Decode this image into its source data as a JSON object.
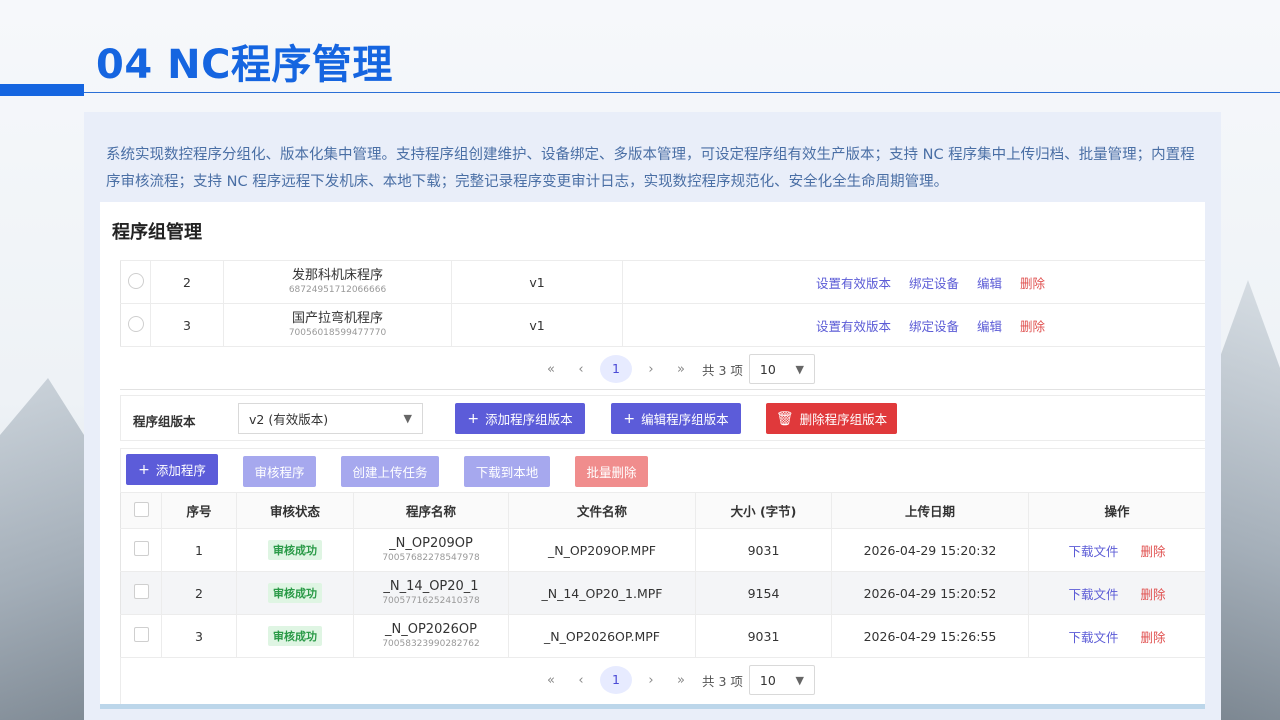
{
  "page": {
    "title": "04 NC程序管理",
    "description": "系统实现数控程序分组化、版本化集中管理。支持程序组创建维护、设备绑定、多版本管理，可设定程序组有效生产版本；支持 NC 程序集中上传归档、批量管理；内置程序审核流程；支持 NC 程序远程下发机床、本地下载；完整记录程序变更审计日志，实现数控程序规范化、安全化全生命周期管理。"
  },
  "colors": {
    "accent": "#1565e0",
    "primary": "#5c5cd9",
    "danger": "#e0393b",
    "success": "#2a9a47"
  },
  "card": {
    "title": "程序组管理"
  },
  "groups": {
    "rows": [
      {
        "index": "2",
        "name": "发那科机床程序",
        "id": "68724951712066666",
        "version": "v1"
      },
      {
        "index": "3",
        "name": "国产拉弯机程序",
        "id": "70056018599477770",
        "version": "v1"
      }
    ],
    "actions": {
      "set_active": "设置有效版本",
      "bind": "绑定设备",
      "edit": "编辑",
      "delete": "删除"
    },
    "pager": {
      "first": "«",
      "prev": "‹",
      "page": "1",
      "next": "›",
      "last": "»",
      "total": "共 3 项",
      "size": "10"
    }
  },
  "version": {
    "label": "程序组版本",
    "selected": "v2 (有效版本)",
    "add": "添加程序组版本",
    "edit": "编辑程序组版本",
    "delete": "删除程序组版本"
  },
  "toolbar": {
    "add": "添加程序",
    "review": "审核程序",
    "upload_task": "创建上传任务",
    "download": "下载到本地",
    "batch_delete": "批量删除"
  },
  "programs": {
    "headers": [
      "序号",
      "审核状态",
      "程序名称",
      "文件名称",
      "大小 (字节)",
      "上传日期",
      "操作"
    ],
    "rows": [
      {
        "index": "1",
        "status": "审核成功",
        "name": "_N_OP209OP",
        "id": "70057682278547978",
        "file": "_N_OP209OP.MPF",
        "size": "9031",
        "date": "2026-04-29 15:20:32"
      },
      {
        "index": "2",
        "status": "审核成功",
        "name": "_N_14_OP20_1",
        "id": "70057716252410378",
        "file": "_N_14_OP20_1.MPF",
        "size": "9154",
        "date": "2026-04-29 15:20:52"
      },
      {
        "index": "3",
        "status": "审核成功",
        "name": "_N_OP2026OP",
        "id": "70058323990282762",
        "file": "_N_OP2026OP.MPF",
        "size": "9031",
        "date": "2026-04-29 15:26:55"
      }
    ],
    "actions": {
      "download": "下载文件",
      "delete": "删除"
    },
    "pager": {
      "first": "«",
      "prev": "‹",
      "page": "1",
      "next": "›",
      "last": "»",
      "total": "共 3 项",
      "size": "10"
    }
  }
}
